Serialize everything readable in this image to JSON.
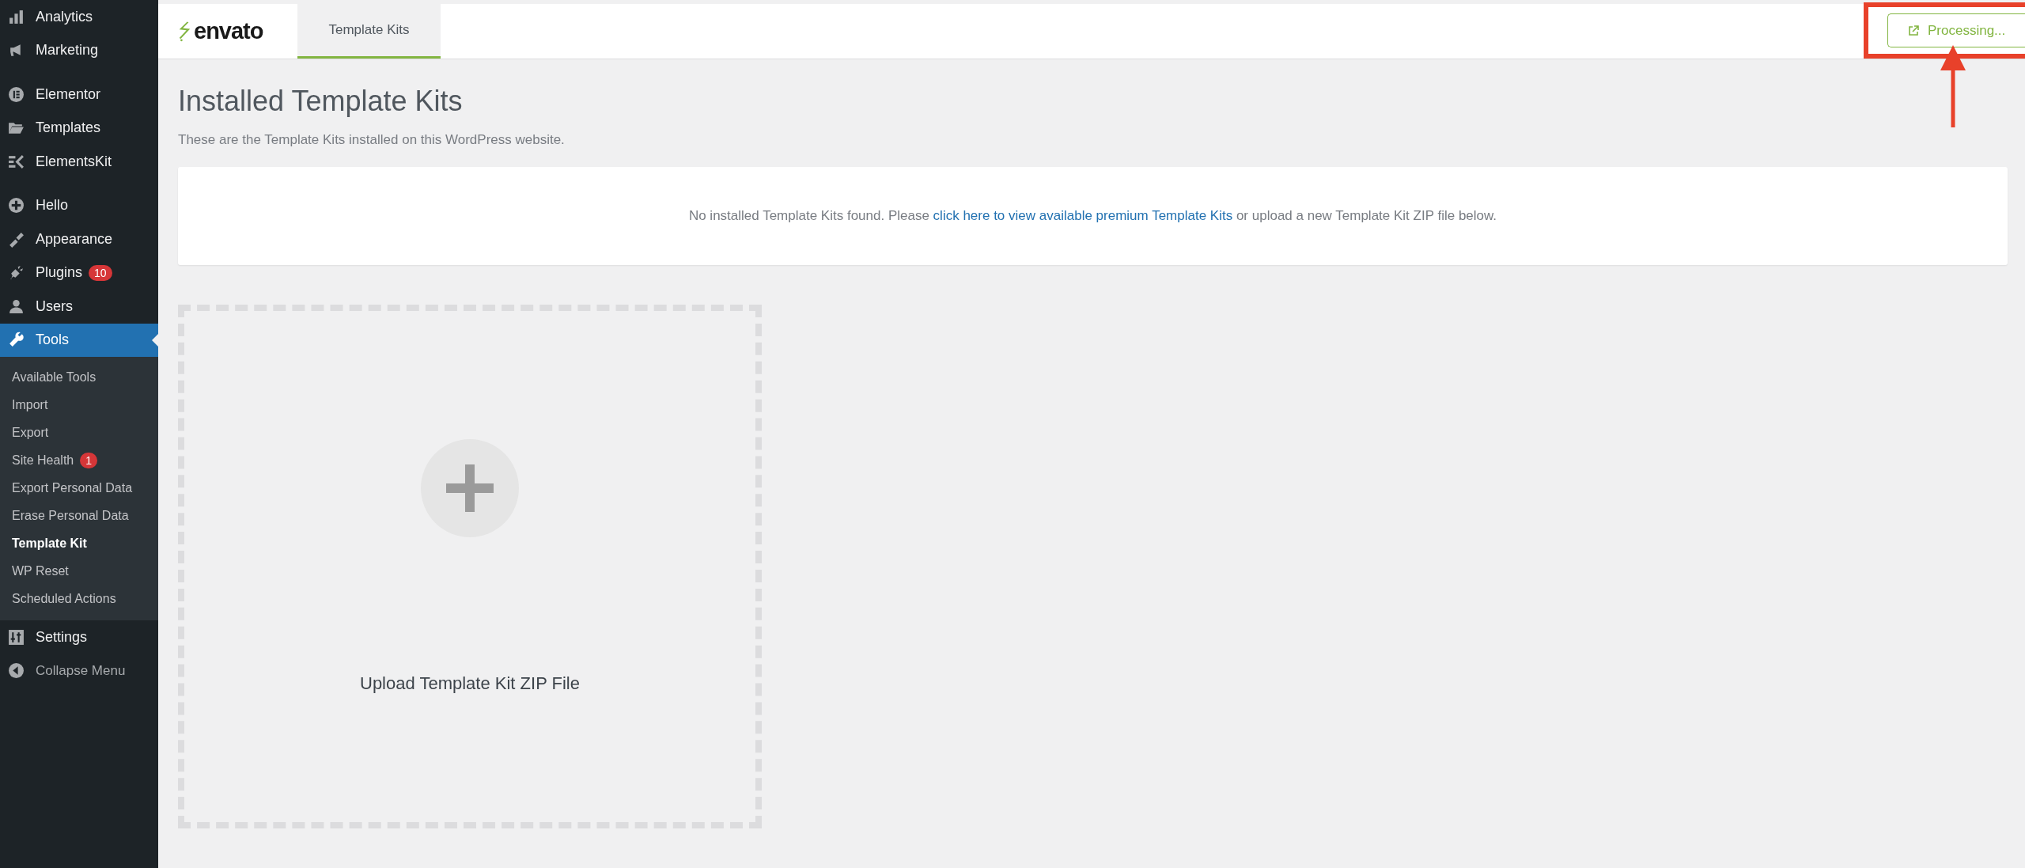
{
  "sidebar": {
    "groups": [
      [
        {
          "label": "Analytics",
          "selected": false
        },
        {
          "label": "Marketing",
          "selected": false
        }
      ],
      [
        {
          "label": "Elementor",
          "selected": false
        },
        {
          "label": "Templates",
          "selected": false
        },
        {
          "label": "ElementsKit",
          "selected": false
        }
      ],
      [
        {
          "label": "Hello",
          "selected": false
        },
        {
          "label": "Appearance",
          "selected": false
        },
        {
          "label": "Plugins",
          "selected": false,
          "badge": "10"
        },
        {
          "label": "Users",
          "selected": false
        },
        {
          "label": "Tools",
          "selected": true,
          "submenu": [
            {
              "label": "Available Tools",
              "selected": false
            },
            {
              "label": "Import",
              "selected": false
            },
            {
              "label": "Export",
              "selected": false
            },
            {
              "label": "Site Health",
              "selected": false,
              "badge": "1"
            },
            {
              "label": "Export Personal Data",
              "selected": false
            },
            {
              "label": "Erase Personal Data",
              "selected": false
            },
            {
              "label": "Template Kit",
              "selected": true
            },
            {
              "label": "WP Reset",
              "selected": false
            },
            {
              "label": "Scheduled Actions",
              "selected": false
            }
          ]
        },
        {
          "label": "Settings",
          "selected": false
        }
      ]
    ],
    "collapse": "Collapse Menu"
  },
  "header": {
    "logo": "envato",
    "tabs": [
      {
        "label": "Template Kits",
        "selected": true
      }
    ],
    "action_button": "Processing..."
  },
  "page": {
    "title": "Installed Template Kits",
    "subtitle": "These are the Template Kits installed on this WordPress website.",
    "notice": "No installed Template Kits found. Please ",
    "notice_link": "click here to view available premium Template Kits",
    "notice_end": " or upload a new Template Kit ZIP file below.",
    "upload_label": "Upload Template Kit ZIP File"
  },
  "annotation": {
    "highlight": true
  }
}
